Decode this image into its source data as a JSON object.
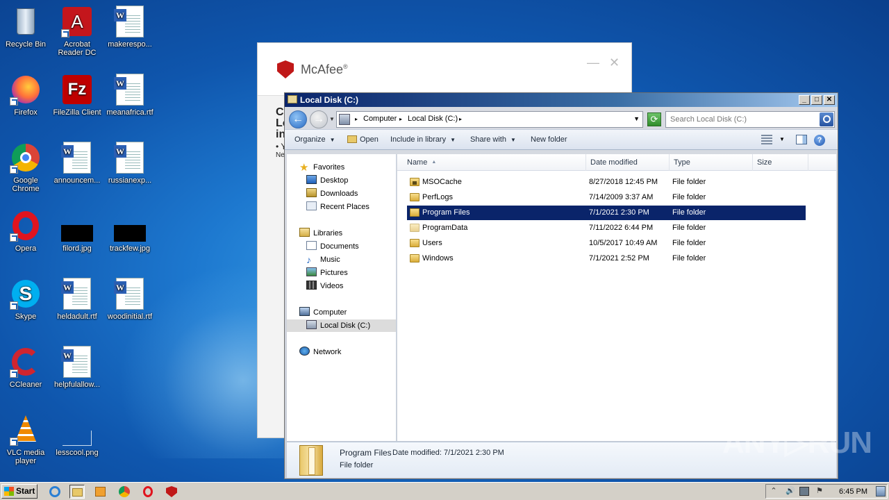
{
  "desktop": {
    "icons": [
      {
        "label": "Recycle Bin"
      },
      {
        "label": "Acrobat Reader DC"
      },
      {
        "label": "makerespo..."
      },
      {
        "label": "Firefox"
      },
      {
        "label": "FileZilla Client"
      },
      {
        "label": "meanafrica.rtf"
      },
      {
        "label": "Google Chrome"
      },
      {
        "label": "announcem..."
      },
      {
        "label": "russianexp..."
      },
      {
        "label": "Opera"
      },
      {
        "label": "filord.jpg"
      },
      {
        "label": "trackfew.jpg"
      },
      {
        "label": "Skype"
      },
      {
        "label": "heldadult.rtf"
      },
      {
        "label": "woodinitial.rtf"
      },
      {
        "label": "CCleaner"
      },
      {
        "label": "helpfulallow..."
      },
      {
        "label": "VLC media player"
      },
      {
        "label": "lesscool.png"
      }
    ]
  },
  "mcafee": {
    "brand": "McAfee",
    "reg": "®",
    "minimize": "—",
    "close": "✕",
    "body_lines": [
      "C",
      "Lo",
      "in"
    ],
    "bullet_text": "• Yo",
    "line_ne": "Ne"
  },
  "explorer": {
    "title": "Local Disk (C:)",
    "window_buttons": {
      "minimize": "_",
      "maximize": "□",
      "close": "✕"
    },
    "address": {
      "crumbs": [
        "Computer",
        "Local Disk (C:)"
      ],
      "separator": "▸"
    },
    "search_placeholder": "Search Local Disk (C:)",
    "commands": {
      "organize": "Organize",
      "open": "Open",
      "include": "Include in library",
      "share": "Share with",
      "newfolder": "New folder"
    },
    "nav": {
      "favorites": "Favorites",
      "desktop": "Desktop",
      "downloads": "Downloads",
      "recent": "Recent Places",
      "libraries": "Libraries",
      "documents": "Documents",
      "music": "Music",
      "pictures": "Pictures",
      "videos": "Videos",
      "computer": "Computer",
      "localdisk": "Local Disk (C:)",
      "network": "Network"
    },
    "columns": {
      "name": "Name",
      "date": "Date modified",
      "type": "Type",
      "size": "Size"
    },
    "files": [
      {
        "name": "MSOCache",
        "date": "8/27/2018 12:45 PM",
        "type": "File folder"
      },
      {
        "name": "PerfLogs",
        "date": "7/14/2009 3:37 AM",
        "type": "File folder"
      },
      {
        "name": "Program Files",
        "date": "7/1/2021 2:30 PM",
        "type": "File folder"
      },
      {
        "name": "ProgramData",
        "date": "7/11/2022 6:44 PM",
        "type": "File folder"
      },
      {
        "name": "Users",
        "date": "10/5/2017 10:49 AM",
        "type": "File folder"
      },
      {
        "name": "Windows",
        "date": "7/1/2021 2:52 PM",
        "type": "File folder"
      }
    ],
    "details": {
      "name": "Program Files",
      "modified_label": "Date modified:",
      "modified": "7/1/2021 2:30 PM",
      "type": "File folder"
    }
  },
  "watermark": "ANY▷RUN",
  "taskbar": {
    "start": "Start",
    "clock": "6:45 PM"
  }
}
